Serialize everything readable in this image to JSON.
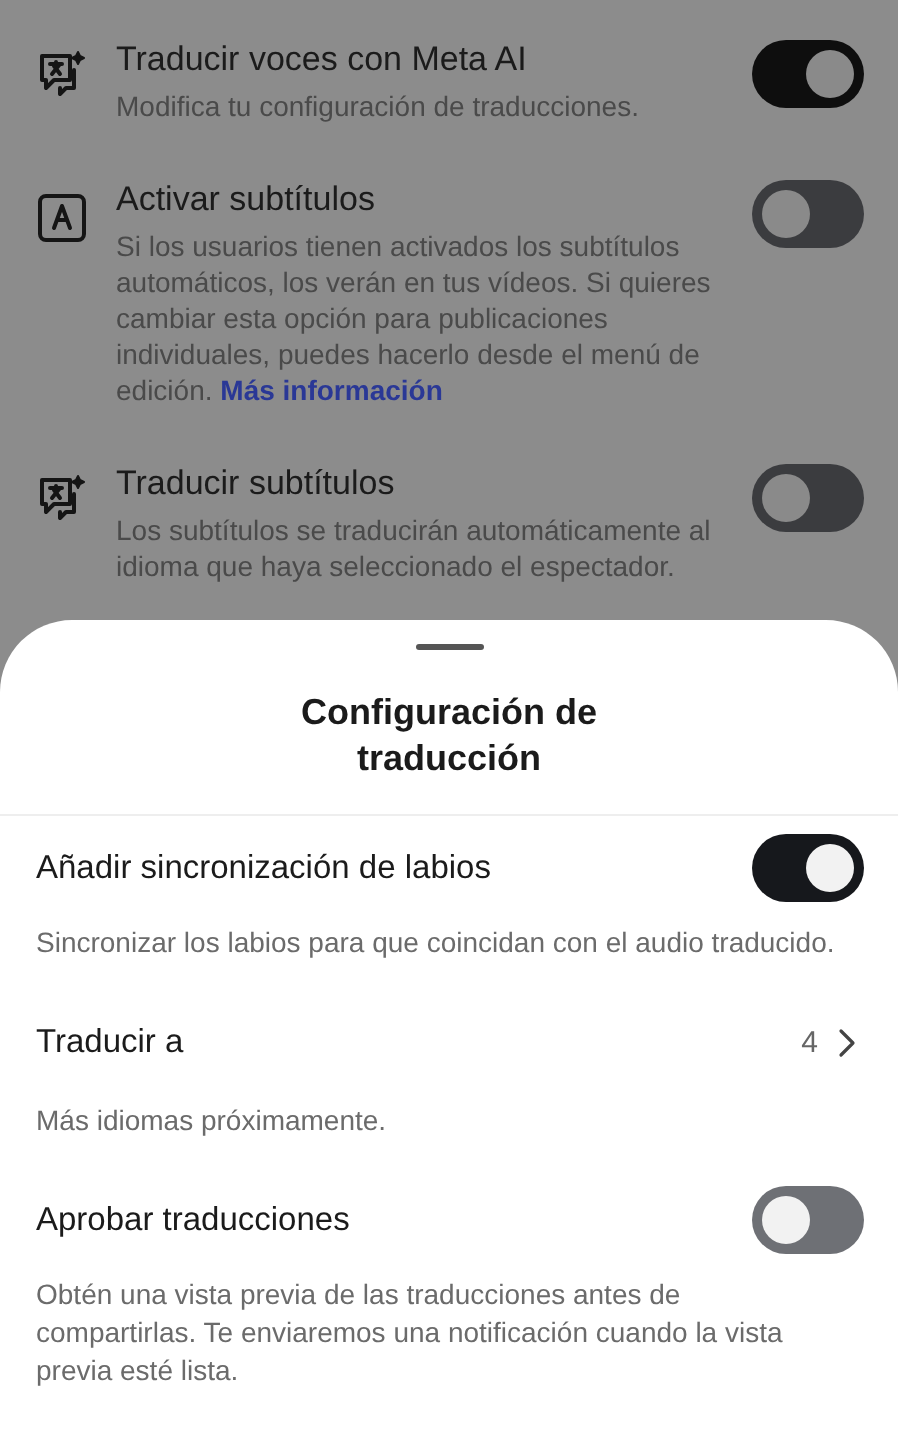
{
  "background_settings": [
    {
      "kind": "translate",
      "title": "Traducir voces con Meta AI",
      "description": "Modifica tu configuración de traducciones.",
      "on": true
    },
    {
      "kind": "captions",
      "title": "Activar subtítulos",
      "description": "Si los usuarios tienen activados los subtítulos automáticos, los verán en tus vídeos. Si quieres cambiar esta opción para publicaciones individuales, puedes hacerlo desde el menú de edición.",
      "link": "Más información",
      "on": false
    },
    {
      "kind": "translate",
      "title": "Traducir subtítulos",
      "description": "Los subtítulos se traducirán automáticamente al idioma que haya seleccionado el espectador.",
      "on": false
    }
  ],
  "sheet": {
    "title": "Configuración de traducción",
    "rows": [
      {
        "kind": "toggle",
        "label": "Añadir sincronización de labios",
        "on": true,
        "description": "Sincronizar los labios para que coincidan con el audio traducido."
      },
      {
        "kind": "link",
        "label": "Traducir a",
        "value": "4",
        "description": "Más idiomas próximamente."
      },
      {
        "kind": "toggle",
        "label": "Aprobar traducciones",
        "on": false,
        "description": "Obtén una vista previa de las traducciones antes de compartirlas. Te enviaremos una notificación cuando la vista previa esté lista."
      }
    ]
  }
}
